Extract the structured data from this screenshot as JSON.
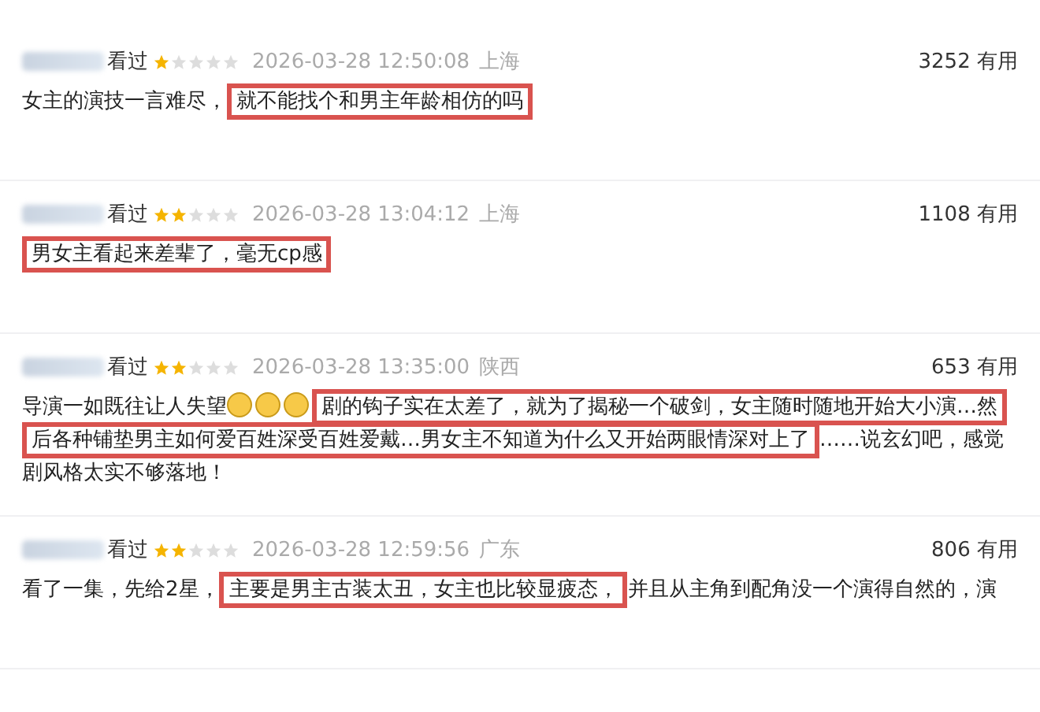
{
  "reviews": [
    {
      "watched": "看过",
      "stars": 1,
      "time": "2026-03-28 12:50:08",
      "location": "上海",
      "useful_count": "3252",
      "useful_label": "有用",
      "segments": [
        {
          "kind": "text",
          "text": "女主的演技一言难尽，"
        },
        {
          "kind": "highlight",
          "text": "就不能找个和男主年龄相仿的吗"
        }
      ]
    },
    {
      "watched": "看过",
      "stars": 2,
      "time": "2026-03-28 13:04:12",
      "location": "上海",
      "useful_count": "1108",
      "useful_label": "有用",
      "segments": [
        {
          "kind": "highlight",
          "text": "男女主看起来差辈了，毫无cp感"
        }
      ]
    },
    {
      "watched": "看过",
      "stars": 2,
      "time": "2026-03-28 13:35:00",
      "location": "陕西",
      "useful_count": "653",
      "useful_label": "有用",
      "segments": [
        {
          "kind": "text",
          "text": "导演一如既往让人失望"
        },
        {
          "kind": "emoji"
        },
        {
          "kind": "emoji"
        },
        {
          "kind": "emoji"
        },
        {
          "kind": "highlight",
          "text": "剧的钩子实在太差了，就为了揭秘一个破剑，女主随时随地开始大小演…然后各种铺垫男主如何爱百姓深受百姓爱戴…男女主不知道为什么又开始两眼情深对上了"
        },
        {
          "kind": "text",
          "text": "……说玄幻吧，感觉剧风格太实不够落地！"
        }
      ]
    },
    {
      "watched": "看过",
      "stars": 2,
      "time": "2026-03-28 12:59:56",
      "location": "广东",
      "useful_count": "806",
      "useful_label": "有用",
      "segments": [
        {
          "kind": "text",
          "text": "看了一集，先给2星，"
        },
        {
          "kind": "highlight",
          "text": "主要是男主古装太丑，女主也比较显疲态，"
        },
        {
          "kind": "text",
          "text": "并且从主角到配角没一个演得自然的，演"
        }
      ]
    }
  ]
}
